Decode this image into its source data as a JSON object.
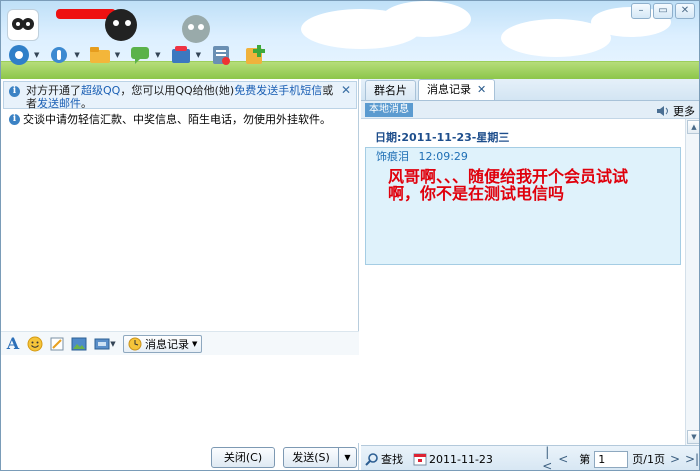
{
  "window": {
    "controls": [
      "–",
      "▭",
      "✕"
    ]
  },
  "colors": {
    "link": "#1a5fb4",
    "message_text": "#e0000c",
    "accent": "#3b82c4"
  },
  "toolbar": {
    "icons": [
      "video-icon",
      "voice-icon",
      "file-transfer-icon",
      "chat-icon",
      "app-icon",
      "note-icon",
      "add-app-icon"
    ]
  },
  "notice": {
    "part1": "对方开通了",
    "link1": "超级QQ",
    "part2": "，您可以用QQ给他(她)",
    "link2": "免费发送手机短信",
    "part3": "或者",
    "link3": "发送邮件",
    "part4": "。"
  },
  "warning": "交谈中请勿轻信汇款、中奖信息、陌生电话，勿使用外挂软件。",
  "formatbar": {
    "history_label": "消息记录"
  },
  "buttons": {
    "close": "关闭(C)",
    "send": "发送(S)"
  },
  "tabs": [
    {
      "label": "群名片"
    },
    {
      "label": "消息记录"
    }
  ],
  "subbar": {
    "local": "本地消息",
    "more": "更多"
  },
  "record": {
    "date": "日期:2011-11-23-星期三",
    "sender": "饰痕泪",
    "time": "12:09:29",
    "text": "风哥啊、、、随便给我开个会员试试啊，你不是在测试电信吗"
  },
  "footer": {
    "find": "查找",
    "date": "2011-11-23",
    "page_prefix": "第",
    "page": "1",
    "page_suffix": "页/1页"
  }
}
